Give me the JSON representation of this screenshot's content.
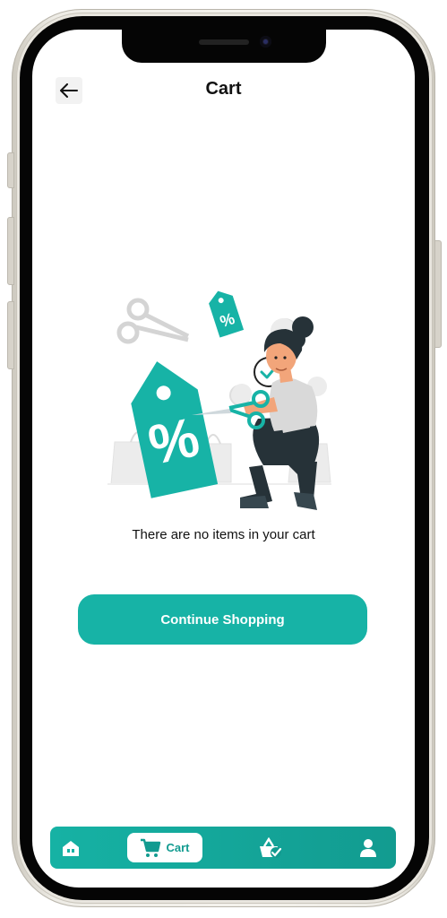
{
  "header": {
    "title": "Cart"
  },
  "empty_state": {
    "message": "There are no items in your cart",
    "button_label": "Continue Shopping"
  },
  "bottom_nav": {
    "active_label": "Cart",
    "items": [
      "home-icon",
      "cart-icon",
      "orders-icon",
      "profile-icon"
    ]
  },
  "colors": {
    "accent": "#17b3a6",
    "accent_dark": "#129b90",
    "text": "#111111"
  }
}
